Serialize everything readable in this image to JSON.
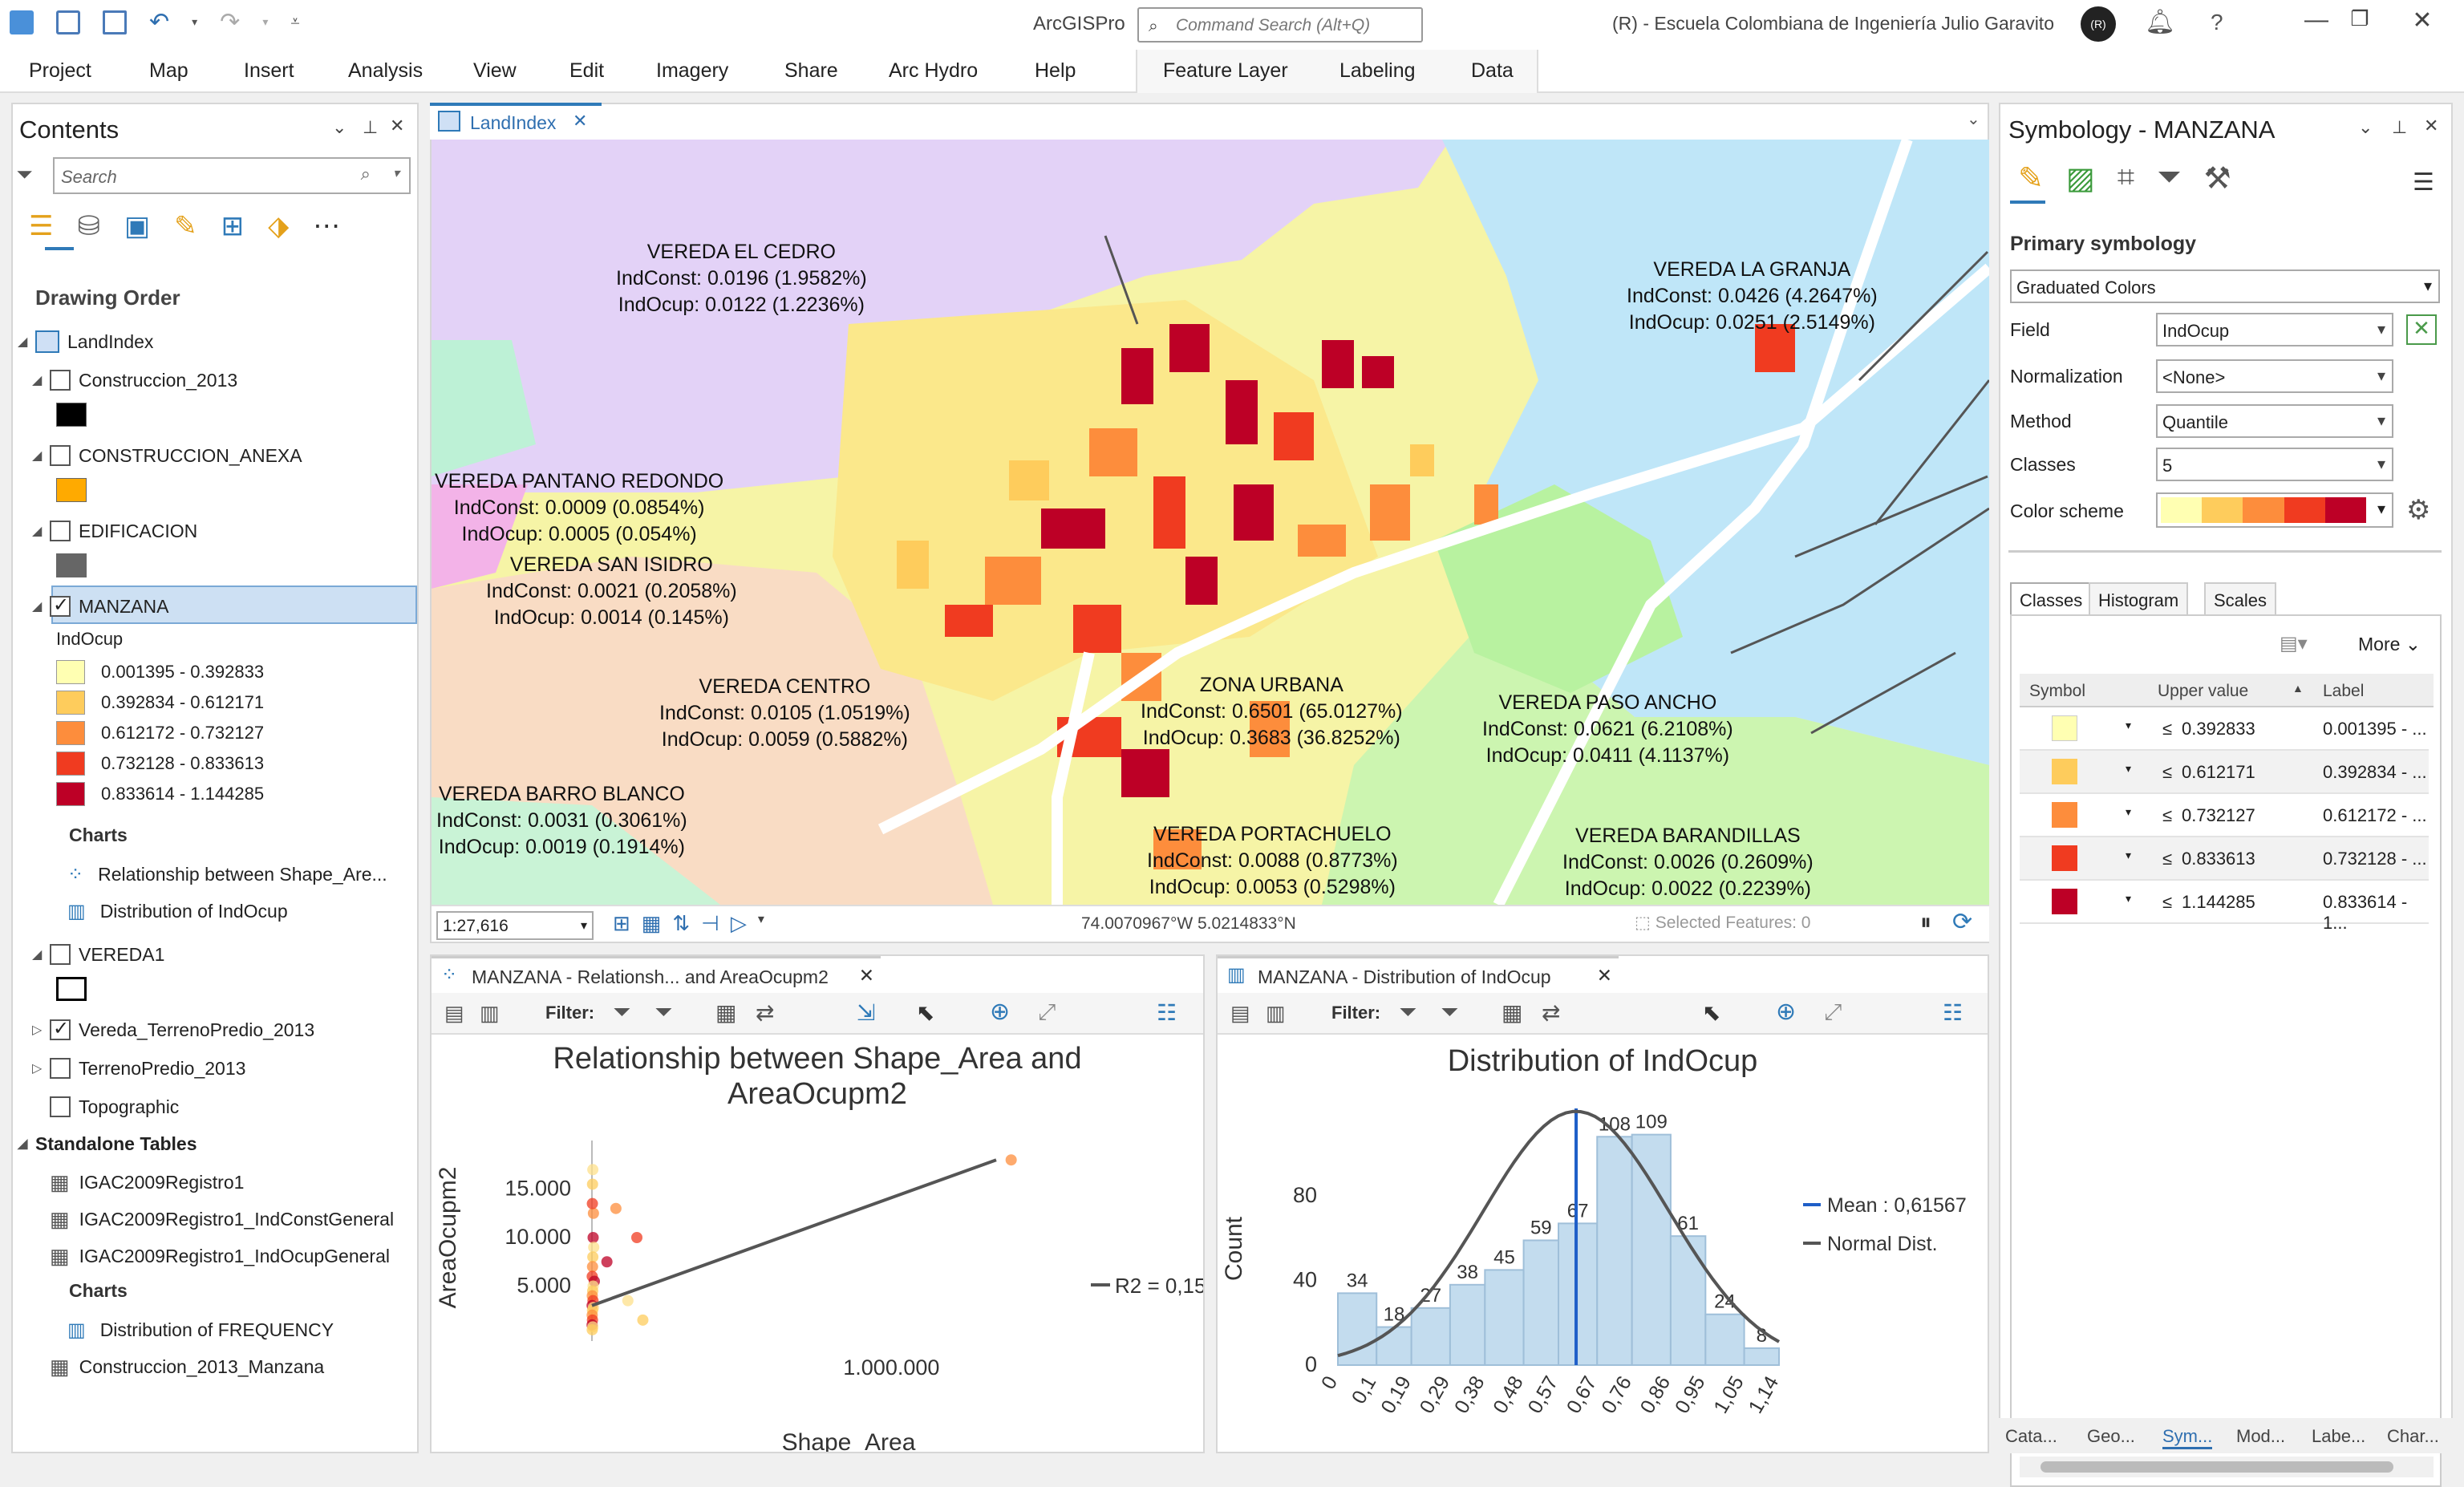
{
  "app": {
    "title": "ArcGISPro",
    "command_search_placeholder": "Command Search (Alt+Q)",
    "org": "(R) - Escuela Colombiana de Ingeniería Julio Garavito",
    "user_initials": "(R)"
  },
  "ribbon": {
    "tabs": [
      "Project",
      "Map",
      "Insert",
      "Analysis",
      "View",
      "Edit",
      "Imagery",
      "Share",
      "Arc Hydro",
      "Help"
    ],
    "context_tabs": [
      "Feature Layer",
      "Labeling",
      "Data"
    ]
  },
  "contents": {
    "title": "Contents",
    "search_placeholder": "Search",
    "drawing_order": "Drawing Order",
    "map_name": "LandIndex",
    "layers": {
      "construccion": "Construccion_2013",
      "construccion_anexa": "CONSTRUCCION_ANEXA",
      "edificacion": "EDIFICACION",
      "manzana": "MANZANA",
      "field": "IndOcup",
      "classes": [
        "0.001395 - 0.392833",
        "0.392834 - 0.612171",
        "0.612172 - 0.732127",
        "0.732128 - 0.833613",
        "0.833614 - 1.144285"
      ],
      "class_colors": [
        "#ffffb2",
        "#fecc5c",
        "#fd8d3c",
        "#f03b20",
        "#bd0026"
      ],
      "charts_label": "Charts",
      "chart1": "Relationship between Shape_Are...",
      "chart2": "Distribution of IndOcup",
      "vereda1": "VEREDA1",
      "vereda_terreno": "Vereda_TerrenoPredio_2013",
      "terreno": "TerrenoPredio_2013",
      "topographic": "Topographic",
      "standalone": "Standalone Tables",
      "t1": "IGAC2009Registro1",
      "t2": "IGAC2009Registro1_IndConstGeneral",
      "t3": "IGAC2009Registro1_IndOcupGeneral",
      "charts2_label": "Charts",
      "chart3": "Distribution of FREQUENCY",
      "t4": "Construccion_2013_Manzana"
    }
  },
  "map": {
    "tab": "LandIndex",
    "scale": "1:27,616",
    "coords": "74.0070967°W 5.0214833°N",
    "selected": "Selected Features: 0",
    "labels": [
      {
        "name": "VEREDA EL CEDRO",
        "c": "IndConst: 0.0196 (1.9582%)",
        "o": "IndOcup: 0.0122 (1.2236%)"
      },
      {
        "name": "VEREDA LA GRANJA",
        "c": "IndConst: 0.0426 (4.2647%)",
        "o": "IndOcup: 0.0251 (2.5149%)"
      },
      {
        "name": "VEREDA PANTANO REDONDO",
        "c": "IndConst: 0.0009 (0.0854%)",
        "o": "IndOcup: 0.0005 (0.054%)"
      },
      {
        "name": "VEREDA SAN ISIDRO",
        "c": "IndConst: 0.0021 (0.2058%)",
        "o": "IndOcup: 0.0014 (0.145%)"
      },
      {
        "name": "VEREDA CENTRO",
        "c": "IndConst: 0.0105 (1.0519%)",
        "o": "IndOcup: 0.0059 (0.5882%)"
      },
      {
        "name": "ZONA URBANA",
        "c": "IndConst: 0.6501 (65.0127%)",
        "o": "IndOcup: 0.3683 (36.8252%)"
      },
      {
        "name": "VEREDA PASO ANCHO",
        "c": "IndConst: 0.0621 (6.2108%)",
        "o": "IndOcup: 0.0411 (4.1137%)"
      },
      {
        "name": "VEREDA BARRO BLANCO",
        "c": "IndConst: 0.0031 (0.3061%)",
        "o": "IndOcup: 0.0019 (0.1914%)"
      },
      {
        "name": "VEREDA PORTACHUELO",
        "c": "IndConst: 0.0088 (0.8773%)",
        "o": "IndOcup: 0.0053 (0.5298%)"
      },
      {
        "name": "VEREDA BARANDILLAS",
        "c": "IndConst: 0.0026 (0.2609%)",
        "o": "IndOcup: 0.0022 (0.2239%)"
      }
    ]
  },
  "chart_panes": {
    "tab1": "MANZANA - Relationsh... and AreaOcupm2",
    "tab2": "MANZANA - Distribution of IndOcup",
    "filter": "Filter:"
  },
  "chart_data": [
    {
      "type": "scatter",
      "title": "Relationship between Shape_Area and AreaOcupm2",
      "title_line1": "Relationship between Shape_Area and",
      "title_line2": "AreaOcupm2",
      "xlabel": "Shape_Area",
      "ylabel": "AreaOcupm2",
      "yticks": [
        "15.000",
        "10.000",
        "5.000"
      ],
      "xticks": [
        "1.000.000"
      ],
      "legend": "R2 = 0,15",
      "ylim": [
        0,
        20000
      ],
      "xlim": [
        0,
        1500000
      ],
      "points": [
        [
          3000,
          17000
        ],
        [
          2000,
          15500
        ],
        [
          5000,
          12500
        ],
        [
          1500,
          13500
        ],
        [
          4000,
          10000
        ],
        [
          6000,
          9000
        ],
        [
          3000,
          8000
        ],
        [
          2000,
          7000
        ],
        [
          1000,
          6000
        ],
        [
          8000,
          5500
        ],
        [
          4000,
          5000
        ],
        [
          2500,
          4500
        ],
        [
          1200,
          4000
        ],
        [
          3500,
          3500
        ],
        [
          700,
          3000
        ],
        [
          5000,
          2800
        ],
        [
          2000,
          2500
        ],
        [
          900,
          2000
        ],
        [
          1800,
          1500
        ],
        [
          600,
          1000
        ],
        [
          3000,
          800
        ],
        [
          1000,
          500
        ],
        [
          80000,
          13000
        ],
        [
          150000,
          10000
        ],
        [
          50000,
          7500
        ],
        [
          120000,
          3500
        ],
        [
          170000,
          1500
        ],
        [
          1400000,
          18000
        ]
      ],
      "trend": [
        [
          0,
          3000
        ],
        [
          1350000,
          18000
        ]
      ]
    },
    {
      "type": "bar",
      "title": "Distribution of IndOcup",
      "xlabel": "IndOcup",
      "ylabel": "Count",
      "categories": [
        "0",
        "0,1",
        "0,19",
        "0,29",
        "0,38",
        "0,48",
        "0,57",
        "0,67",
        "0,76",
        "0,86",
        "0,95",
        "1,05",
        "1,14"
      ],
      "bin_edges": [
        0,
        0.1,
        0.19,
        0.29,
        0.38,
        0.48,
        0.57,
        0.67,
        0.76,
        0.86,
        0.95,
        1.05,
        1.14
      ],
      "values": [
        34,
        18,
        27,
        38,
        45,
        59,
        67,
        108,
        109,
        61,
        24,
        8
      ],
      "yticks": [
        0,
        40,
        80
      ],
      "ylim": [
        0,
        110
      ],
      "mean": 0.61567,
      "mean_label": "Mean : 0,61567",
      "normal_label": "Normal Dist."
    }
  ],
  "symbology": {
    "title": "Symbology - MANZANA",
    "primary": "Primary symbology",
    "method_type": "Graduated Colors",
    "field_label": "Field",
    "field": "IndOcup",
    "norm_label": "Normalization",
    "norm": "<None>",
    "method_label": "Method",
    "method": "Quantile",
    "classes_label": "Classes",
    "classes": "5",
    "scheme_label": "Color scheme",
    "tabs": [
      "Classes",
      "Histogram",
      "Scales"
    ],
    "more": "More",
    "cols": [
      "Symbol",
      "Upper value",
      "Label"
    ],
    "rows": [
      {
        "op": "≤",
        "upper": "0.392833",
        "label": "0.001395 - ..."
      },
      {
        "op": "≤",
        "upper": "0.612171",
        "label": "0.392834 - ..."
      },
      {
        "op": "≤",
        "upper": "0.732127",
        "label": "0.612172 - ..."
      },
      {
        "op": "≤",
        "upper": "0.833613",
        "label": "0.732128 - ..."
      },
      {
        "op": "≤",
        "upper": "1.144285",
        "label": "0.833614 - 1..."
      }
    ]
  },
  "bottom_tabs": [
    "Cata...",
    "Geo...",
    "Sym...",
    "Mod...",
    "Labe...",
    "Char..."
  ]
}
